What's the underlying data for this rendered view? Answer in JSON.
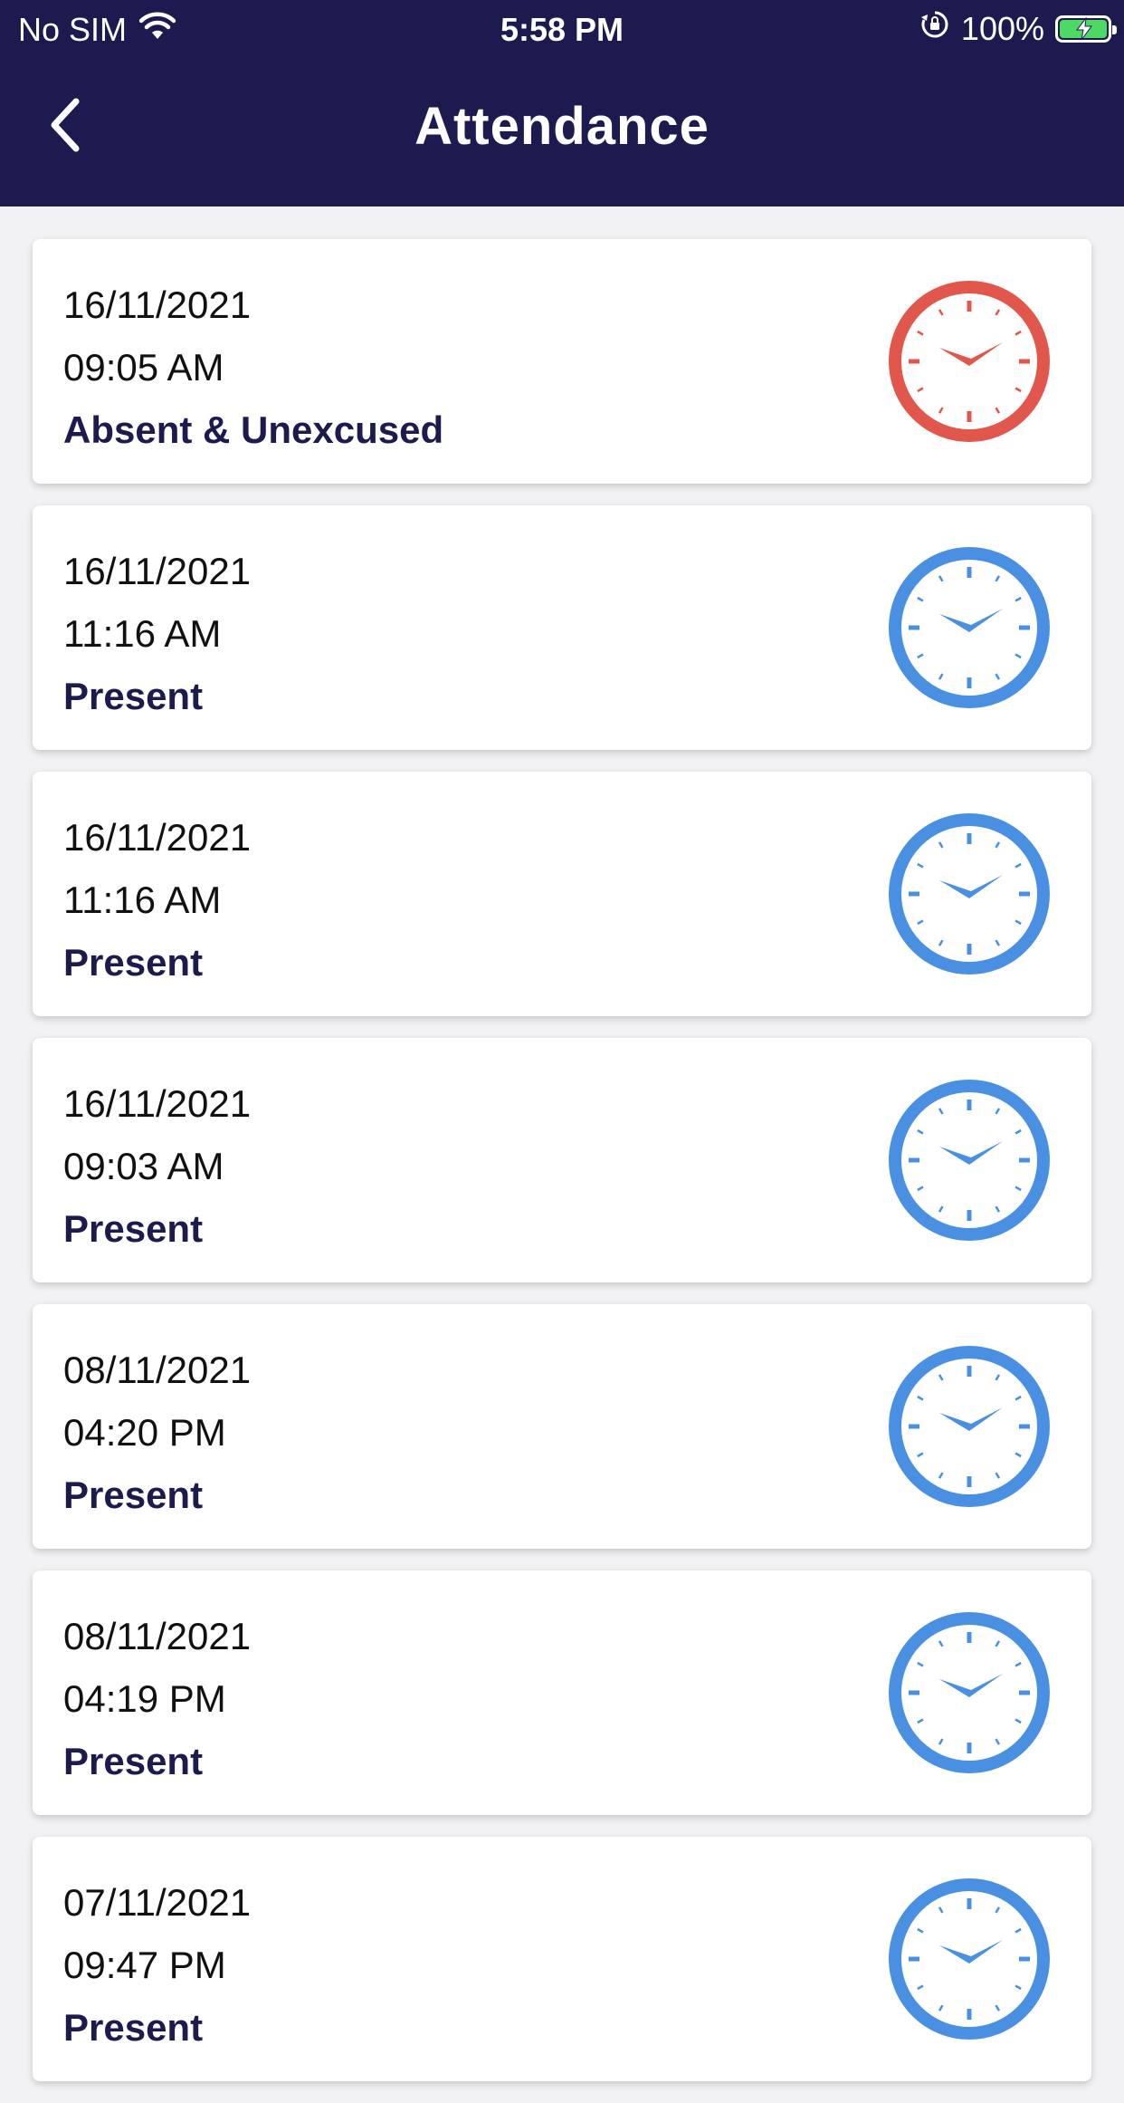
{
  "status_bar": {
    "carrier": "No SIM",
    "time": "5:58 PM",
    "battery": "100%",
    "battery_level": 1.0,
    "icons": [
      "wifi-icon",
      "orientation-lock-icon",
      "battery-charging-icon"
    ]
  },
  "header": {
    "title": "Attendance",
    "back_icon": "chevron-left-icon"
  },
  "colors": {
    "header_bg": "#1c1a4f",
    "status_text": "#1c1a4f",
    "absent_clock": "#e2574c",
    "present_clock": "#4a90e2",
    "page_bg": "#f2f2f4"
  },
  "records": [
    {
      "date": "16/11/2021",
      "time": "09:05 AM",
      "status": "Absent & Unexcused",
      "icon": "clock-icon",
      "type": "absent"
    },
    {
      "date": "16/11/2021",
      "time": "11:16 AM",
      "status": "Present",
      "icon": "clock-icon",
      "type": "present"
    },
    {
      "date": "16/11/2021",
      "time": "11:16 AM",
      "status": "Present",
      "icon": "clock-icon",
      "type": "present"
    },
    {
      "date": "16/11/2021",
      "time": "09:03 AM",
      "status": "Present",
      "icon": "clock-icon",
      "type": "present"
    },
    {
      "date": "08/11/2021",
      "time": "04:20 PM",
      "status": "Present",
      "icon": "clock-icon",
      "type": "present"
    },
    {
      "date": "08/11/2021",
      "time": "04:19 PM",
      "status": "Present",
      "icon": "clock-icon",
      "type": "present"
    },
    {
      "date": "07/11/2021",
      "time": "09:47 PM",
      "status": "Present",
      "icon": "clock-icon",
      "type": "present"
    }
  ]
}
